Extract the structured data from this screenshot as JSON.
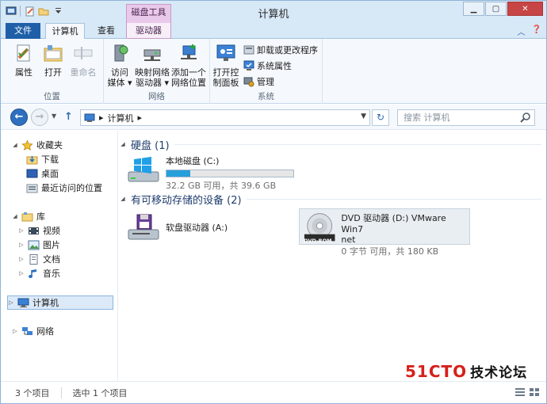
{
  "window": {
    "title": "计算机",
    "context_tab_group": "磁盘工具"
  },
  "tabs": {
    "file": "文件",
    "computer": "计算机",
    "view": "查看",
    "drive": "驱动器"
  },
  "ribbon": {
    "location_group": {
      "label": "位置",
      "properties": "属性",
      "open": "打开",
      "rename": "重命名"
    },
    "network_group": {
      "label": "网络",
      "access_media_l1": "访问",
      "access_media_l2": "媒体 ▾",
      "map_drive_l1": "映射网络",
      "map_drive_l2": "驱动器 ▾",
      "add_location_l1": "添加一个",
      "add_location_l2": "网络位置"
    },
    "system_group": {
      "label": "系统",
      "control_panel_l1": "打开控",
      "control_panel_l2": "制面板",
      "uninstall": "卸载或更改程序",
      "sys_props": "系统属性",
      "manage": "管理"
    }
  },
  "address": {
    "path_item": "计算机",
    "search_placeholder": "搜索 计算机"
  },
  "navpane": {
    "favorites": "收藏夹",
    "downloads": "下载",
    "desktop": "桌面",
    "recent": "最近访问的位置",
    "libraries": "库",
    "videos": "视频",
    "pictures": "图片",
    "documents": "文档",
    "music": "音乐",
    "computer": "计算机",
    "network": "网络"
  },
  "content": {
    "hard_disks_header": "硬盘 (1)",
    "local_disk": {
      "name": "本地磁盘 (C:)",
      "usage": "32.2 GB 可用，共 39.6 GB",
      "used_fraction": 0.19
    },
    "removable_header": "有可移动存储的设备 (2)",
    "floppy": {
      "name": "软盘驱动器 (A:)"
    },
    "dvd": {
      "name_l1": "DVD 驱动器 (D:) VMware Win7",
      "name_l2": "net",
      "usage": "0 字节 可用，共 180 KB",
      "badge": "DVD-ROM"
    }
  },
  "status": {
    "item_count": "3 个项目",
    "selected": "选中 1 个项目"
  },
  "watermark": {
    "brand": "51CTO",
    "text": "技术论坛"
  },
  "colors": {
    "accent": "#1f5fa8",
    "context_tab": "#e9c9ea",
    "disk_bar": "#26a0da"
  }
}
